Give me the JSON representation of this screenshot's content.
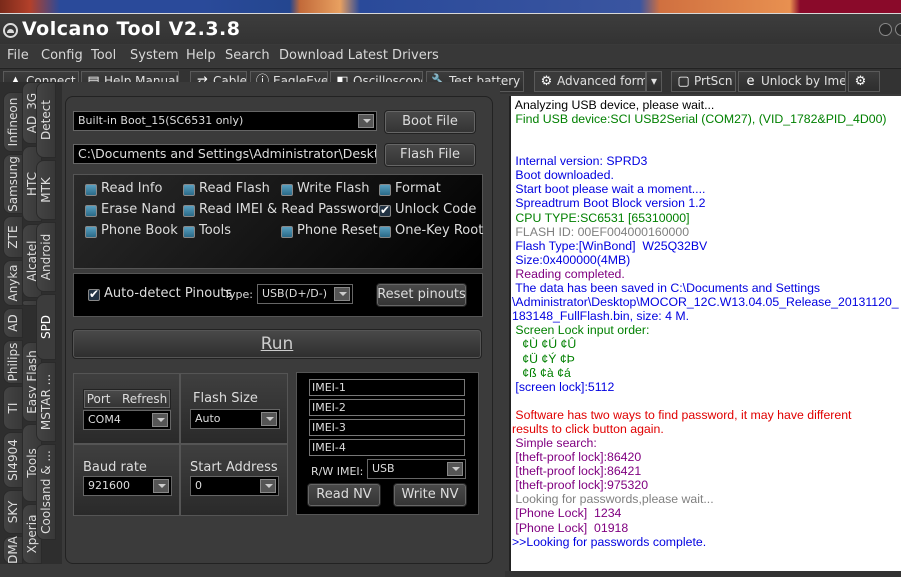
{
  "window": {
    "title": "Volcano Tool V2.3.8"
  },
  "menu": [
    "File",
    "Config",
    "Tool",
    "System",
    "Help",
    "Search",
    "Download Latest Drivers"
  ],
  "toolbar": [
    {
      "label": "Connect",
      "icon": "warning-icon"
    },
    {
      "label": "Help Manuals",
      "icon": "manual-icon"
    },
    {
      "label": "Cable",
      "icon": "cable-icon"
    },
    {
      "label": "EagleEye",
      "icon": "info-icon"
    },
    {
      "label": "Oscilloscope",
      "icon": "oscilloscope-icon"
    },
    {
      "label": "Test battery",
      "icon": "wrench-icon"
    },
    {
      "label": "Advanced form",
      "icon": "gear-icon"
    },
    {
      "label": "PrtScn",
      "icon": "screenshot-icon"
    },
    {
      "label": "Unlock by Imei",
      "icon": "ie-icon"
    }
  ],
  "vtabs": {
    "col1": [
      "Infineon",
      "Samsung",
      "ZTE",
      "Anyka",
      "AD",
      "Philips",
      "TI",
      "SI4904",
      "SKY",
      "DMA"
    ],
    "col2": [
      "AD_3G",
      "HTC",
      "Alcatel",
      "SPD",
      "Easy Flash",
      "Tools",
      "Xperia"
    ],
    "col3": [
      "Detect",
      "MTK",
      "Android",
      "SPD",
      "MSTAR ...",
      "Coolsand & ..."
    ],
    "active": "SPD"
  },
  "boot": {
    "selected": "Built-in Boot_15(SC6531 only)",
    "boot_file_label": "Boot File"
  },
  "flash": {
    "path": "C:\\Documents and Settings\\Administrator\\Desktop\\ma",
    "flash_file_label": "Flash File"
  },
  "options": [
    {
      "label": "Read Info",
      "checked": false
    },
    {
      "label": "Read Flash",
      "checked": false
    },
    {
      "label": "Write Flash",
      "checked": false
    },
    {
      "label": "Format",
      "checked": false
    },
    {
      "label": "Erase Nand",
      "checked": false
    },
    {
      "label": "Read IMEI & Read Password",
      "checked": false
    },
    {
      "label": "Unlock Code",
      "checked": true
    },
    {
      "label": "Phone Book",
      "checked": false
    },
    {
      "label": "Tools",
      "checked": false
    },
    {
      "label": "Phone Reset",
      "checked": false
    },
    {
      "label": "One-Key Root",
      "checked": false
    }
  ],
  "pinouts": {
    "auto_detect_label": "Auto-detect Pinouts",
    "auto_detect_checked": true,
    "type_label": "Type:",
    "type_value": "USB(D+/D-)",
    "reset_label": "Reset pinouts"
  },
  "run_label": "Run",
  "port": {
    "port_label": "Port",
    "refresh_label": "Refresh",
    "value": "COM4"
  },
  "flash_size": {
    "label": "Flash Size",
    "value": "Auto"
  },
  "baud": {
    "label": "Baud rate",
    "value": "921600"
  },
  "start_address": {
    "label": "Start Address",
    "value": "0"
  },
  "imei": {
    "fields": [
      "IMEI-1",
      "IMEI-2",
      "IMEI-3",
      "IMEI-4"
    ],
    "rw_label": "R/W IMEI:",
    "rw_value": "USB",
    "read_label": "Read NV",
    "write_label": "Write NV"
  },
  "log": [
    {
      "text": " Analyzing USB device, please wait...",
      "color": "#000000"
    },
    {
      "text": " Find USB device:SCI USB2Serial (COM27), (VID_1782&PID_4D00)",
      "color": "#008000"
    },
    {
      "text": "",
      "color": "#000000"
    },
    {
      "text": "",
      "color": "#000000"
    },
    {
      "text": " Internal version: SPRD3",
      "color": "#0000e0"
    },
    {
      "text": " Boot downloaded.",
      "color": "#0000e0"
    },
    {
      "text": " Start boot please wait a moment....",
      "color": "#0000e0"
    },
    {
      "text": " Spreadtrum Boot Block version 1.2",
      "color": "#0000e0"
    },
    {
      "text": " CPU TYPE:SC6531 [65310000]",
      "color": "#008000"
    },
    {
      "text": " FLASH ID: 00EF004000160000",
      "color": "#808080"
    },
    {
      "text": " Flash Type:[WinBond]  W25Q32BV",
      "color": "#0000e0"
    },
    {
      "text": " Size:0x400000(4MB)",
      "color": "#0000e0"
    },
    {
      "text": " Reading completed.",
      "color": "#800080"
    },
    {
      "text": " The data has been saved in C:\\Documents and Settings",
      "color": "#0000e0"
    },
    {
      "text": "\\Administrator\\Desktop\\MOCOR_12C.W13.04.05_Release_20131120_",
      "color": "#0000e0"
    },
    {
      "text": "183148_FullFlash.bin, size: 4 M.",
      "color": "#0000e0"
    },
    {
      "text": " Screen Lock input order:",
      "color": "#008000"
    },
    {
      "text": "   ¢Ù ¢Ú ¢Û",
      "color": "#008000"
    },
    {
      "text": "   ¢Ü ¢Ý ¢Þ",
      "color": "#008000"
    },
    {
      "text": "   ¢ß ¢à ¢á",
      "color": "#008000"
    },
    {
      "text": " [screen lock]:5112",
      "color": "#0000e0"
    },
    {
      "text": "",
      "color": "#000000"
    },
    {
      "text": " Software has two ways to find password, it may have different",
      "color": "#e00000"
    },
    {
      "text": "results to click button again.",
      "color": "#e00000"
    },
    {
      "text": " Simple search:",
      "color": "#800080"
    },
    {
      "text": " [theft-proof lock]:86420",
      "color": "#800080"
    },
    {
      "text": " [theft-proof lock]:86421",
      "color": "#800080"
    },
    {
      "text": " [theft-proof lock]:975320",
      "color": "#800080"
    },
    {
      "text": " Looking for passwords,please wait...",
      "color": "#808080"
    },
    {
      "text": " [Phone Lock]  1234",
      "color": "#800080"
    },
    {
      "text": " [Phone Lock]  01918",
      "color": "#800080"
    },
    {
      "text": ">>Looking for passwords complete.",
      "color": "#0000e0"
    }
  ]
}
